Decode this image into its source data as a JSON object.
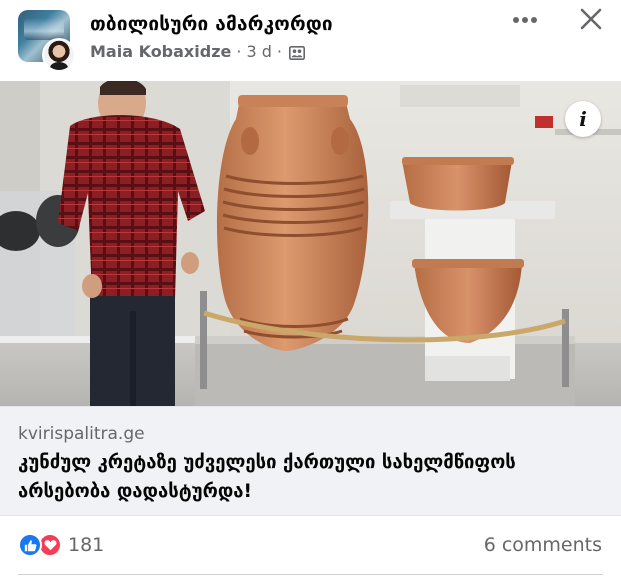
{
  "post": {
    "group_name": "თბილისური ამარკორდი",
    "author": "Maia Kobaxidze",
    "time": "3 d",
    "dot": "·"
  },
  "link_preview": {
    "domain": "kvirispalitra.ge",
    "title": "კუნძულ კრეტაზე უძველესი ქართული სახელმწიფოს არსებობა დადასტურდა!"
  },
  "engagement": {
    "reaction_count": "181",
    "comments": "6 comments"
  },
  "icons": {
    "more": "more-horizontal-icon",
    "close": "close-icon",
    "info": "info-icon",
    "privacy": "group-icon",
    "like": "like-icon",
    "love": "love-icon"
  },
  "colors": {
    "like_blue": "#1877f2",
    "love_red": "#f33e58",
    "secondary_text": "#65676b",
    "link_box_bg": "#f0f2f5"
  }
}
